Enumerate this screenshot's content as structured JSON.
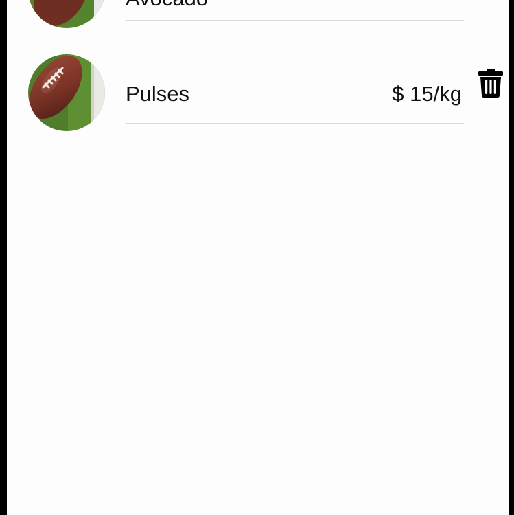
{
  "items": [
    {
      "name": "Avocado",
      "price": "",
      "image_icon": "football-on-turf-image"
    },
    {
      "name": "Pulses",
      "price": "$ 15/kg",
      "image_icon": "football-on-turf-image",
      "action_icon": "trash-icon"
    }
  ],
  "colors": {
    "background": "#fdfdfd",
    "text": "#111111",
    "divider": "#d9d9d9",
    "bezel": "#000000"
  }
}
